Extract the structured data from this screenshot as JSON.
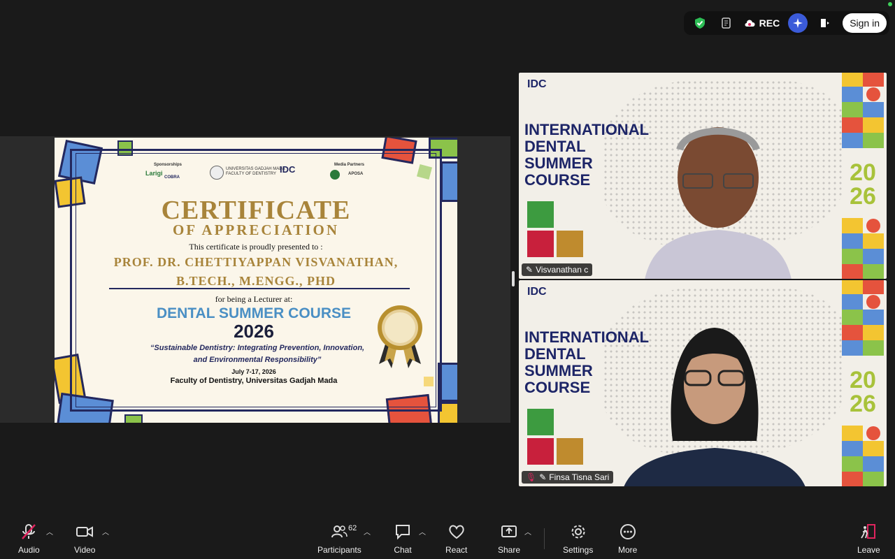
{
  "topbar": {
    "rec_label": "REC",
    "signin_label": "Sign in"
  },
  "certificate": {
    "sponsorship_label": "Sponsorships",
    "media_label": "Media Partners",
    "sponsor1": "Larigi",
    "sponsor2": "COBRA",
    "university_line1": "UNIVERSITAS GADJAH MADA",
    "university_line2": "FACULTY OF DENTISTRY",
    "logo_text": "IDC",
    "media_partner": "APOSA",
    "title": "CERTIFICATE",
    "subtitle": "OF APPRECIATION",
    "presented": "This certificate is proudly presented to :",
    "name_line1": "PROF. DR. CHETTIYAPPAN VISVANATHAN,",
    "name_line2": "B.TECH., M.ENGG., PHD",
    "lecturer": "for being a Lecturer at:",
    "course": "DENTAL SUMMER COURSE",
    "year": "2026",
    "theme_line1": "“Sustainable Dentistry: Integrating Prevention, Innovation,",
    "theme_line2": "and Environmental Responsibility”",
    "dates": "July 7-17, 2026",
    "faculty": "Faculty of Dentistry, Universitas Gadjah Mada"
  },
  "tiles": [
    {
      "name": "Visvanathan c",
      "bg_title_lines": [
        "INTERNATIONAL",
        "DENTAL",
        "SUMMER",
        "COURSE"
      ],
      "year_top": "20",
      "year_bottom": "26"
    },
    {
      "name": "Finsa Tisna Sari",
      "bg_title_lines": [
        "INTERNATIONAL",
        "DENTAL",
        "SUMMER",
        "COURSE"
      ],
      "year_top": "20",
      "year_bottom": "26"
    }
  ],
  "toolbar": {
    "audio": "Audio",
    "video": "Video",
    "participants": "Participants",
    "participants_count": "62",
    "chat": "Chat",
    "react": "React",
    "share": "Share",
    "settings": "Settings",
    "more": "More",
    "leave": "Leave"
  },
  "colors": {
    "gold": "#a8843a",
    "navy": "#1d2567",
    "accent_blue": "#4a8fc4"
  }
}
